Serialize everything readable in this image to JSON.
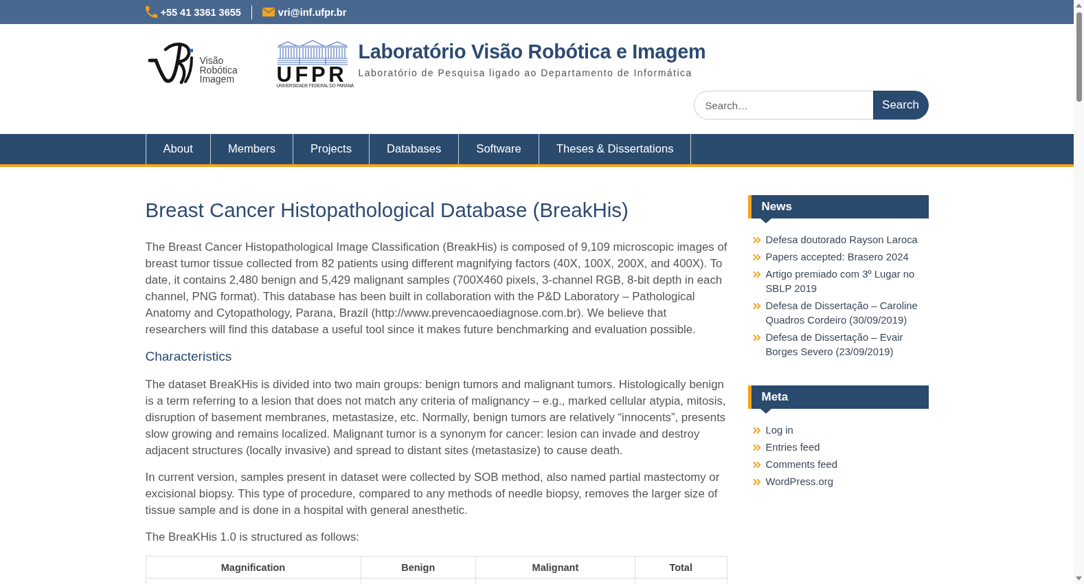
{
  "top_bar": {
    "phone": "+55 41 3361 3655",
    "email": "vri@inf.ufpr.br"
  },
  "header": {
    "lab_logo_text": "Visão Robótica Imagem",
    "university_logo": {
      "wordmark": "UFPR",
      "caption": "UNIVERSIDADE FEDERAL DO PARANÁ"
    },
    "site_title": "Laboratório Visão Robótica e Imagem",
    "tagline": "Laboratório de Pesquisa ligado ao Departamento de Informática",
    "search": {
      "placeholder": "Search…",
      "button": "Search"
    }
  },
  "nav": {
    "items": [
      "About",
      "Members",
      "Projects",
      "Databases",
      "Software",
      "Theses & Dissertations"
    ]
  },
  "article": {
    "title": "Breast Cancer Histopathological Database (BreakHis)",
    "blocks": [
      {
        "kind": "paragraph",
        "text": "The Breast Cancer Histopathological Image Classification (BreakHis) is composed of 9,109 microscopic images of breast tumor tissue collected from 82 patients using different magnifying factors (40X, 100X, 200X, and 400X). To date, it contains 2,480 benign and 5,429 malignant samples (700X460 pixels, 3-channel RGB, 8-bit depth in each channel, PNG format). This database has been built in collaboration with the P&D Laboratory – Pathological Anatomy and Cytopathology, Parana, Brazil (http://www.prevencaoediagnose.com.br). We believe that researchers will find this database a useful tool since it makes future benchmarking and evaluation possible."
      },
      {
        "kind": "heading",
        "text": "Characteristics"
      },
      {
        "kind": "paragraph",
        "text": "The dataset BreaKHis is divided into two main groups: benign tumors and malignant tumors. Histologically benign is a term referring to a lesion that does not match any criteria of malignancy – e.g., marked cellular atypia, mitosis, disruption of basement membranes, metastasize, etc. Normally, benign tumors are relatively “innocents”, presents slow growing and remains localized. Malignant tumor is a synonym for cancer: lesion can invade and destroy adjacent structures (locally invasive) and spread to distant sites (metastasize) to cause death."
      },
      {
        "kind": "paragraph",
        "text": "In current version, samples present in dataset were collected by SOB method, also named partial mastectomy or excisional biopsy. This type of procedure, compared to any methods of needle biopsy, removes the larger size of tissue sample and is done in a hospital with general anesthetic."
      },
      {
        "kind": "paragraph",
        "text": "The BreaKHis 1.0 is structured as follows:"
      }
    ],
    "table": {
      "columns": [
        "Magnification",
        "Benign",
        "Malignant",
        "Total"
      ]
    }
  },
  "sidebar": {
    "widgets": [
      {
        "title": "News",
        "items": [
          "Defesa doutorado Rayson Laroca",
          "Papers accepted: Brasero 2024",
          "Artigo premiado com 3º Lugar no SBLP 2019",
          "Defesa de Dissertação – Caroline Quadros Cordeiro (30/09/2019)",
          "Defesa de Dissertação – Evair Borges Severo (23/09/2019)"
        ]
      },
      {
        "title": "Meta",
        "items": [
          "Log in",
          "Entries feed",
          "Comments feed",
          "WordPress.org"
        ]
      }
    ]
  }
}
